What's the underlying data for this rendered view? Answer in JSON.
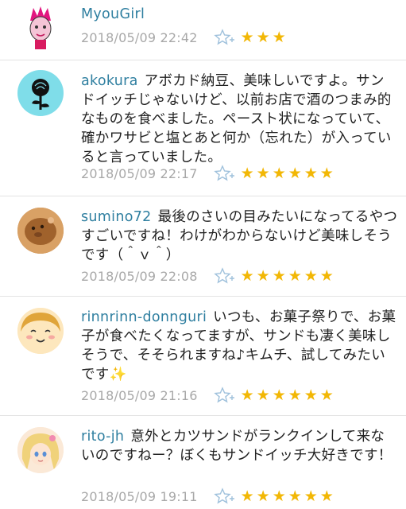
{
  "colors": {
    "username": "#2f7fa0",
    "star": "#f2b705",
    "date": "#a8a8a8",
    "fav_icon": "#9fc1dc"
  },
  "comments": [
    {
      "user": "MyouGirl",
      "text": "",
      "date": "2018/05/09 22:42",
      "rating": 3,
      "stars_text": "★★★",
      "avatar": "pink-hair-girl-icon"
    },
    {
      "user": "akokura",
      "text": "アボカド納豆、美味しいですよ。サンドイッチじゃないけど、以前お店で酒のつまみ的なものを食べました。ペースト状になっていて、確かワサビと塩とあと何か（忘れた）が入っていると言っていました。",
      "date": "2018/05/09 22:17",
      "rating": 6,
      "stars_text": "★★★★★★",
      "avatar": "black-rose-icon"
    },
    {
      "user": "sumino72",
      "text": "最後のさいの目みたいになってるやつすごいですね！わけがわからないけど美味しそうです（＾ｖ＾）",
      "date": "2018/05/09 22:08",
      "rating": 6,
      "stars_text": "★★★★★★",
      "avatar": "round-animal-photo-icon"
    },
    {
      "user": "rinnrinn-donnguri",
      "text": "いつも、お菓子祭りで、お菓子が食べたくなってますが、サンドも凄く美味しそうで、そそられますね♪キムチ、試してみたいです✨",
      "date": "2018/05/09 21:16",
      "rating": 6,
      "stars_text": "★★★★★★",
      "avatar": "smiling-face-icon"
    },
    {
      "user": "rito-jh",
      "text": "意外とカツサンドがランクインして来ないのですねー？ぼくもサンドイッチ大好きです！",
      "date": "2018/05/09 19:11",
      "rating": 6,
      "stars_text": "★★★★★★",
      "avatar": "anime-girl-icon"
    }
  ]
}
